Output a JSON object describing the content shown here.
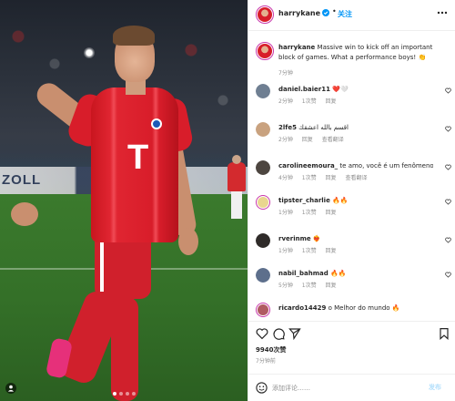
{
  "post": {
    "author": "harrykane",
    "follow_label": "关注",
    "caption_text": "Massive win to kick off an important block of games. What a performance boys! 👏",
    "caption_time": "7分钟"
  },
  "photo": {
    "boards_text": "ZOLL",
    "shirt_logo": "T"
  },
  "comments": [
    {
      "user": "daniel.baier11",
      "text": "❤️🤍",
      "time": "2分钟",
      "likes": "1次赞",
      "reply": "回复",
      "has_likes": true
    },
    {
      "user": "2lfe5",
      "text": "اقسم بالله اعشقك",
      "time": "2分钟",
      "likes": "回复",
      "reply": "查看翻译",
      "has_likes": false
    },
    {
      "user": "carolineemoura_",
      "text": "te amo, você é um fenômeno",
      "time": "4分钟",
      "likes": "1次赞",
      "reply": "回复",
      "translate": "查看翻译",
      "has_likes": true
    },
    {
      "user": "tipster_charlie",
      "text": "🔥🔥",
      "time": "1分钟",
      "likes": "1次赞",
      "reply": "回复",
      "has_likes": true
    },
    {
      "user": "rverinme",
      "text": "❤️‍🔥",
      "time": "1分钟",
      "likes": "1次赞",
      "reply": "回复",
      "has_likes": true
    },
    {
      "user": "nabil_bahmad",
      "text": "🔥🔥",
      "time": "5分钟",
      "likes": "1次赞",
      "reply": "回复",
      "has_likes": true
    },
    {
      "user": "ricardo14429",
      "text": "o Melhor do mundo 🔥",
      "time": "",
      "likes": "",
      "reply": "",
      "has_likes": false
    }
  ],
  "actions": {
    "likes_count": "9940次赞",
    "post_time": "7分钟前"
  },
  "comment_box": {
    "placeholder": "添加评论……",
    "post_label": "发布"
  },
  "colors": {
    "accent": "#0095f6",
    "jersey_red": "#d81d2a",
    "text": "#262626",
    "muted": "#8e8e8e"
  },
  "icons": [
    "verified-badge-icon",
    "more-options-icon",
    "heart-icon",
    "comment-icon",
    "share-icon",
    "bookmark-icon",
    "emoji-icon",
    "user-tag-icon"
  ]
}
